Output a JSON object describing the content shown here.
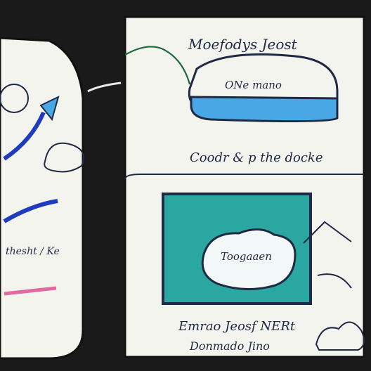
{
  "labels": {
    "top_title": "Moefodys Jeost",
    "top_subtitle": "ONe mano",
    "top_caption": "Coodr & p the docke",
    "bottom_inner": "Toogaaen",
    "bottom_caption_1": "Emrao Jeosf NERt",
    "bottom_caption_2": "Donmado Jino",
    "left_note": "thesht / Ke"
  },
  "colors": {
    "background": "#1a1a1a",
    "paper": "#f4f4ef",
    "ink": "#1f2a44",
    "blue_arrow": "#1f3bbf",
    "light_blue": "#4aa7e6",
    "teal": "#2aa7a0",
    "pink": "#e26aa0",
    "green": "#1e6a3a"
  }
}
